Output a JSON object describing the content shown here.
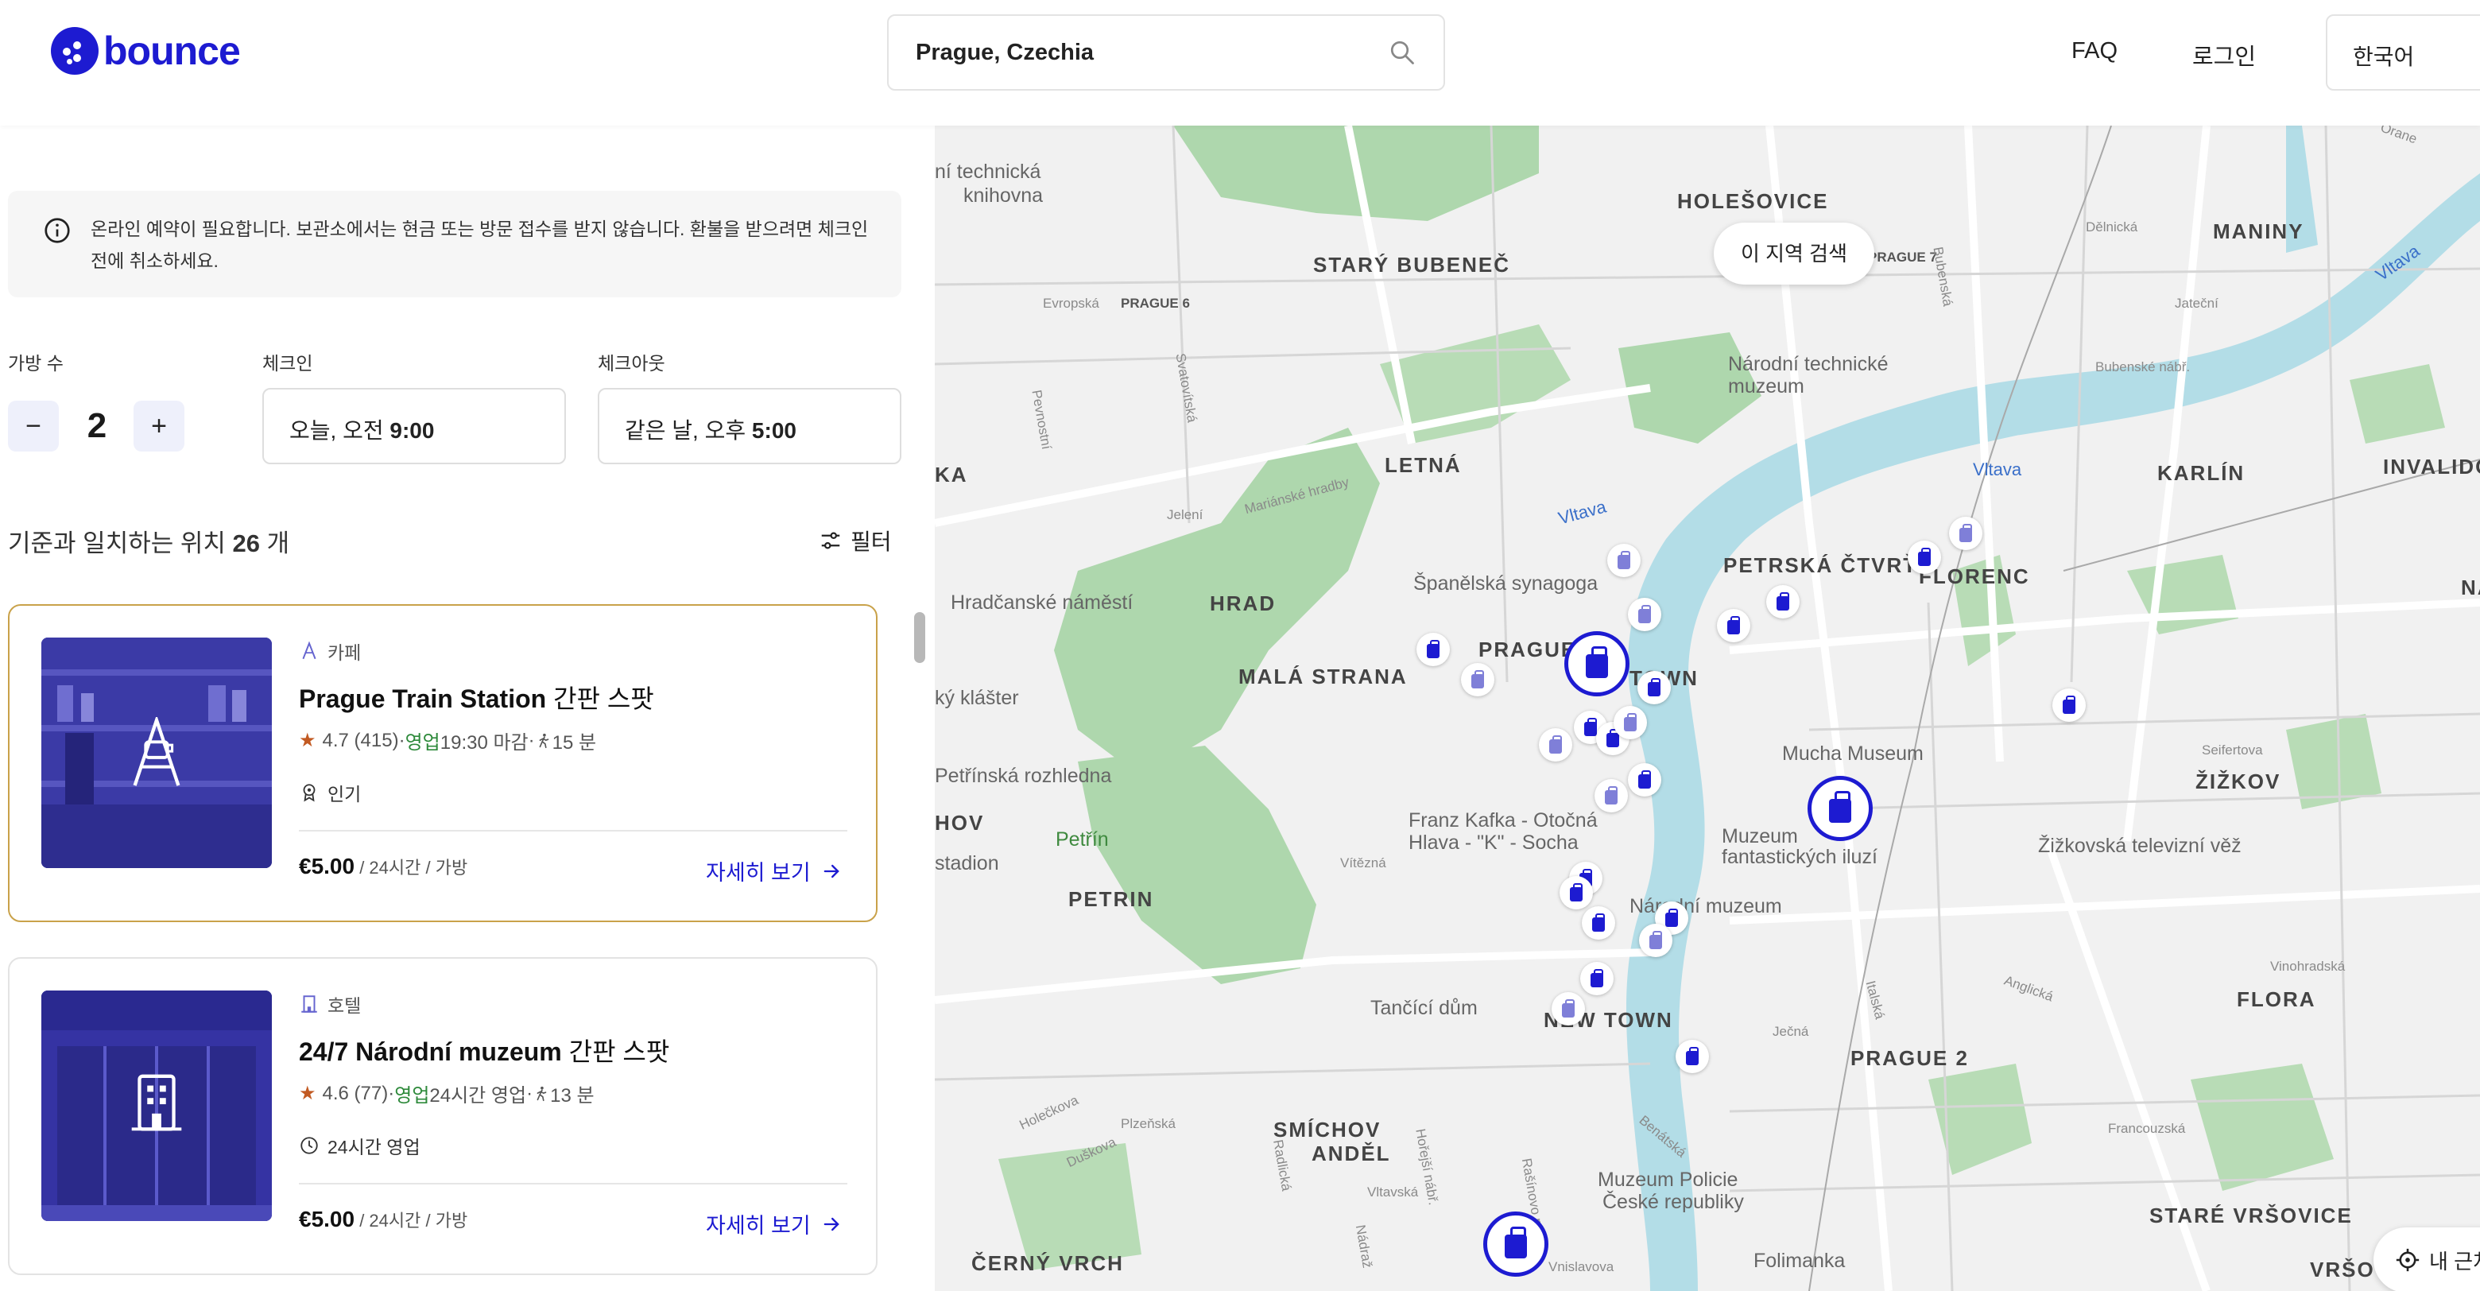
{
  "header": {
    "logo_text": "bounce",
    "search_value": "Prague, Czechia",
    "faq": "FAQ",
    "login": "로그인",
    "language": "한국어"
  },
  "notice": "온라인 예약이 필요합니다. 보관소에서는 현금 또는 방문 접수를 받지 않습니다. 환불을 받으려면 체크인 전에 취소하세요.",
  "booking": {
    "bags_label": "가방 수",
    "bags_minus": "−",
    "bags_count": "2",
    "bags_plus": "+",
    "checkin_label": "체크인",
    "checkin_prefix": "오늘, 오전 ",
    "checkin_time": "9:00",
    "checkout_label": "체크아웃",
    "checkout_prefix": "같은 날, 오후 ",
    "checkout_time": "5:00"
  },
  "results": {
    "prefix": "기준과 일치하는 위치 ",
    "count": "26",
    "suffix": " 개",
    "filter_label": "필터"
  },
  "listings": [
    {
      "category": "카페",
      "name": "Prague Train Station",
      "suffix": " 간판 스팟",
      "rating": "4.7 (415)",
      "sep1": "·",
      "status": "영업",
      "hours": " 19:30 마감",
      "sep2": "·",
      "walk": "15 분",
      "feature": "인기",
      "price": "€5.00",
      "unit": " / 24시간 / 가방",
      "details": "자세히 보기"
    },
    {
      "category": "호텔",
      "name": "24/7 Národní muzeum",
      "suffix": " 간판 스팟",
      "rating": "4.6 (77)",
      "sep1": "·",
      "status": "영업",
      "hours": " 24시간 영업",
      "sep2": "·",
      "walk": "13 분",
      "feature": "24시간 영업",
      "price": "€5.00",
      "unit": " / 24시간 / 가방",
      "details": "자세히 보기"
    }
  ],
  "map": {
    "search_area": "이 지역 검색",
    "near_me": "내 근처",
    "districts": [
      "HOLEŠOVICE",
      "STARÝ BUBENEČ",
      "MANINY",
      "LETNÁ",
      "KARLÍN",
      "INVALIDOV",
      "PETRSKÁ ČTVRŤ",
      "FLORENC",
      "HRAD",
      "MALÁ STRANA",
      "PRAGUE",
      "TOWN",
      "ŽIŽKOV",
      "PETRIN",
      "NEW TOWN",
      "PRAGUE 2",
      "FLORA",
      "SMÍCHOV",
      "ANDĚL",
      "STARÉ VRŠOVICE",
      "ČERNÝ VRCH",
      "VRŠO",
      "HOV",
      "KA",
      "NA",
      "PRAGUE 6",
      "PRAGUE 7"
    ],
    "pois": [
      "ní technická",
      "knihovna",
      "Národní technické",
      "muzeum",
      "Španělská synagoga",
      "Hradčanské náměstí",
      "ký klášter",
      "Mucha Museum",
      "Petřínská rozhledna",
      "Petřín",
      "Franz Kafka - Otočná",
      "Hlava - \"K\" - Socha",
      "Muzeum",
      "fantastických iluzí",
      "Žižkovská televizní věž",
      "Národní muzeum",
      "stadion",
      "Tančící dům",
      "Muzeum Policie",
      "České republiky",
      "Folimanka"
    ],
    "rivers": [
      "Vltava",
      "Vltava",
      "Vltava"
    ],
    "streets": [
      "Evropská",
      "Dělnická",
      "Jateční",
      "Bubenské nábř.",
      "Svatovítská",
      "Pevnostní",
      "Jelení",
      "Mariánské hradby",
      "Vítězná",
      "Holečkova",
      "Duškova",
      "Plzeňská",
      "Radlická",
      "Vltavská",
      "Seifertova",
      "Vinohradská",
      "Francouzská",
      "Anglická",
      "Ječná",
      "Italská",
      "Benátská",
      "Rašínovo nábř.",
      "Vnislavova",
      "Nádraž",
      "Hořejší nábř.",
      "Bubenská",
      "Orane"
    ]
  }
}
